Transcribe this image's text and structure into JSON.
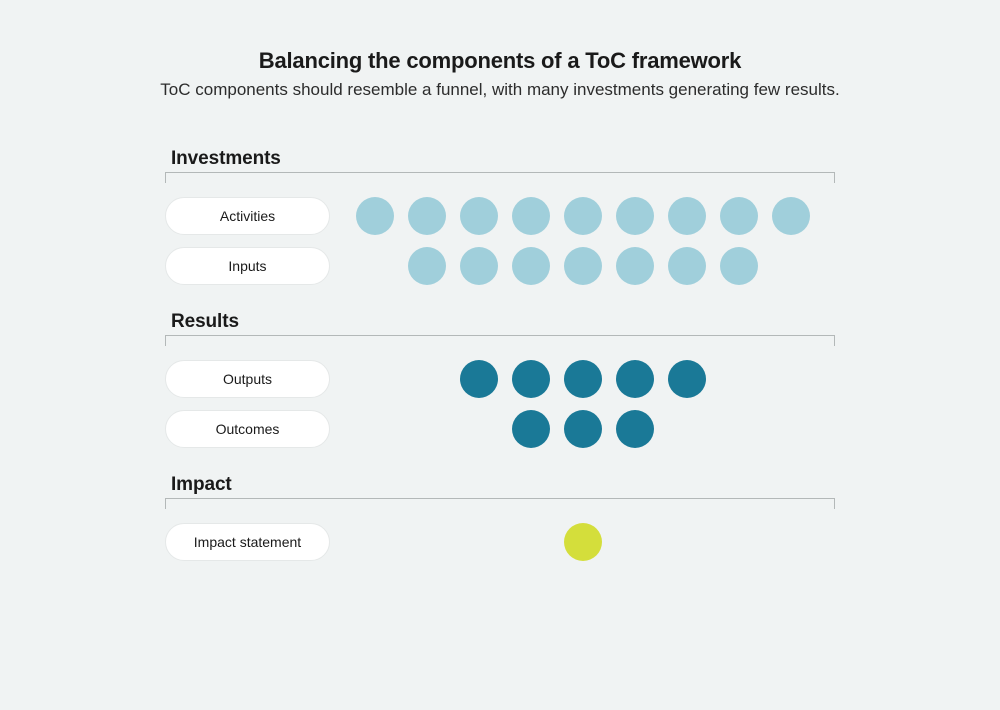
{
  "title": "Balancing the components of a ToC framework",
  "subtitle": "ToC components should resemble a funnel, with many investments generating few results.",
  "colors": {
    "light_blue": "#a0cfdb",
    "dark_teal": "#1a7997",
    "chartreuse": "#d4de3b"
  },
  "sections": [
    {
      "title": "Investments",
      "rows": [
        {
          "pill": "Activities",
          "dots": 9,
          "color": "light"
        },
        {
          "pill": "Inputs",
          "dots": 7,
          "color": "light"
        }
      ]
    },
    {
      "title": "Results",
      "rows": [
        {
          "pill": "Outputs",
          "dots": 5,
          "color": "dark"
        },
        {
          "pill": "Outcomes",
          "dots": 3,
          "color": "dark"
        }
      ]
    },
    {
      "title": "Impact",
      "rows": [
        {
          "pill": "Impact statement",
          "dots": 1,
          "color": "lime"
        }
      ]
    }
  ],
  "chart_data": {
    "type": "bar",
    "title": "Balancing the components of a ToC framework",
    "categories": [
      "Activities",
      "Inputs",
      "Outputs",
      "Outcomes",
      "Impact statement"
    ],
    "values": [
      9,
      7,
      5,
      3,
      1
    ],
    "groups": [
      "Investments",
      "Investments",
      "Results",
      "Results",
      "Impact"
    ],
    "xlabel": "",
    "ylabel": "",
    "ylim": [
      0,
      9
    ]
  }
}
